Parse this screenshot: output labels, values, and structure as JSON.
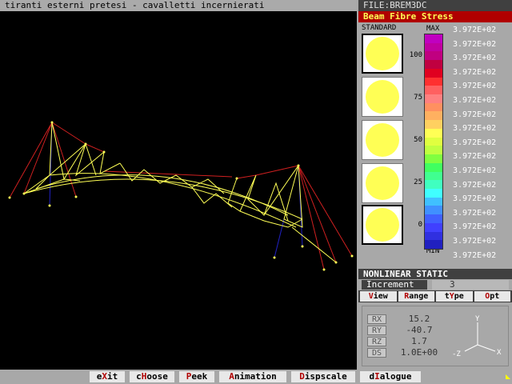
{
  "title": "tiranti esterni pretesi - cavalletti incernierati",
  "file_label": "FILE:BREM3DC",
  "result_title": "Beam Fibre Stress",
  "standard_label": "STANDARD",
  "scale": {
    "max_label": "MAX",
    "min_label": "MIN",
    "percent_ticks": [
      "100",
      "75",
      "50",
      "25",
      "0"
    ],
    "values": [
      "3.972E+02",
      "3.972E+02",
      "3.972E+02",
      "3.972E+02",
      "3.972E+02",
      "3.972E+02",
      "3.972E+02",
      "3.972E+02",
      "3.972E+02",
      "3.972E+02",
      "3.972E+02",
      "3.972E+02",
      "3.972E+02",
      "3.972E+02",
      "3.972E+02",
      "3.972E+02",
      "3.972E+02"
    ],
    "colors": [
      "#c000c0",
      "#c000a0",
      "#c00080",
      "#c00040",
      "#e00020",
      "#ff3030",
      "#ff6060",
      "#ff8080",
      "#ff9060",
      "#ffb060",
      "#ffd060",
      "#ffff55",
      "#e0ff40",
      "#c0ff40",
      "#80ff40",
      "#40ff60",
      "#40ff90",
      "#40ffc0",
      "#40ffff",
      "#40c0ff",
      "#4090ff",
      "#4060ff",
      "#4040ff",
      "#3030e0",
      "#2020c0"
    ]
  },
  "analysis_type": "NONLINEAR STATIC",
  "increment": {
    "label": "Increment",
    "value": "3"
  },
  "panel_menu": [
    {
      "key": "V",
      "rest": "iew",
      "pre": ""
    },
    {
      "key": "R",
      "rest": "ange",
      "pre": ""
    },
    {
      "key": "Y",
      "rest": "pe",
      "pre": "t"
    },
    {
      "key": "O",
      "rest": "pt",
      "pre": ""
    }
  ],
  "rotation": [
    {
      "label": "RX",
      "value": "15.2"
    },
    {
      "label": "RY",
      "value": "-40.7"
    },
    {
      "label": "RZ",
      "value": "1.7"
    },
    {
      "label": "DS",
      "value": "1.0E+00"
    }
  ],
  "axes": {
    "y": "Y",
    "x": "X",
    "z": "-Z"
  },
  "bottom_menu": [
    {
      "pre": "e",
      "key": "X",
      "rest": "it"
    },
    {
      "pre": "c",
      "key": "H",
      "rest": "oose"
    },
    {
      "pre": "",
      "key": "P",
      "rest": "eek"
    },
    {
      "pre": "",
      "key": "A",
      "rest": "nimation"
    },
    {
      "pre": "",
      "key": "D",
      "rest": "ispscale"
    },
    {
      "pre": "d",
      "key": "I",
      "rest": "alogue"
    }
  ]
}
